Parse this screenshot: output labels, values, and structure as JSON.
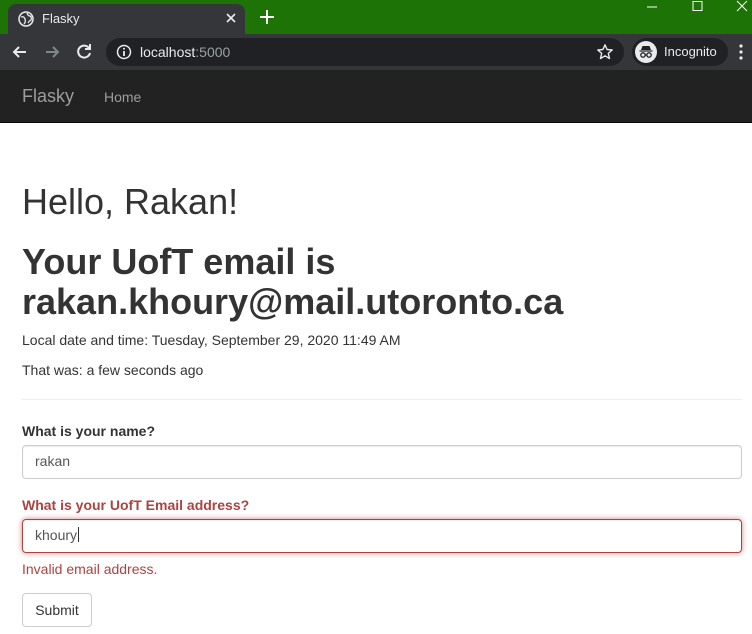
{
  "browser": {
    "tab_title": "Flasky",
    "url_host": "localhost",
    "url_port": ":5000",
    "incognito_label": "Incognito",
    "tabbar_color": "#1d7306"
  },
  "navbar": {
    "brand": "Flasky",
    "links": [
      {
        "label": "Home"
      }
    ]
  },
  "main": {
    "greeting": "Hello, Rakan!",
    "email_line1": "Your UofT email is",
    "email_line2": "rakan.khoury@mail.utoronto.ca",
    "datetime": "Local date and time: Tuesday, September 29, 2020 11:49 AM",
    "ago": "That was: a few seconds ago"
  },
  "form": {
    "name_label": "What is your name?",
    "name_value": "rakan",
    "email_label": "What is your UofT Email address?",
    "email_value": "khoury",
    "email_error": "Invalid email address.",
    "submit_label": "Submit",
    "error_color": "#a94442"
  }
}
